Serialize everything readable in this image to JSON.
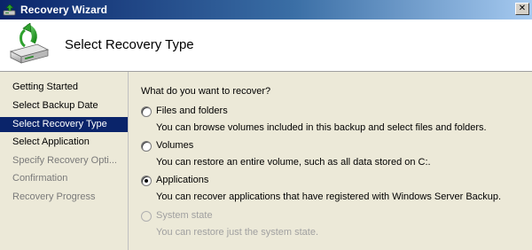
{
  "window": {
    "title": "Recovery Wizard",
    "close_glyph": "✕",
    "icon": "recovery-wizard-icon"
  },
  "header": {
    "title": "Select Recovery Type",
    "icon": "backup-disk-restore-icon"
  },
  "sidebar": {
    "steps": [
      {
        "label": "Getting Started",
        "state": "completed"
      },
      {
        "label": "Select Backup Date",
        "state": "completed"
      },
      {
        "label": "Select Recovery Type",
        "state": "active"
      },
      {
        "label": "Select Application",
        "state": "pending"
      },
      {
        "label": "Specify Recovery Opti...",
        "state": "disabled"
      },
      {
        "label": "Confirmation",
        "state": "disabled"
      },
      {
        "label": "Recovery Progress",
        "state": "disabled"
      }
    ]
  },
  "main": {
    "question": "What do you want to recover?",
    "options": [
      {
        "label": "Files and folders",
        "description": "You can browse volumes included in this backup and select files and folders.",
        "selected": false,
        "enabled": true
      },
      {
        "label": "Volumes",
        "description": "You can restore an entire volume, such as all data stored on C:.",
        "selected": false,
        "enabled": true
      },
      {
        "label": "Applications",
        "description": "You can recover applications that have registered with Windows Server Backup.",
        "selected": true,
        "enabled": true
      },
      {
        "label": "System state",
        "description": "You can restore just the system state.",
        "selected": false,
        "enabled": false
      }
    ]
  },
  "colors": {
    "titlebar_start": "#0a246a",
    "titlebar_end": "#a6caf0",
    "selection": "#0a246a",
    "disabled_text": "#a0a0a0"
  }
}
